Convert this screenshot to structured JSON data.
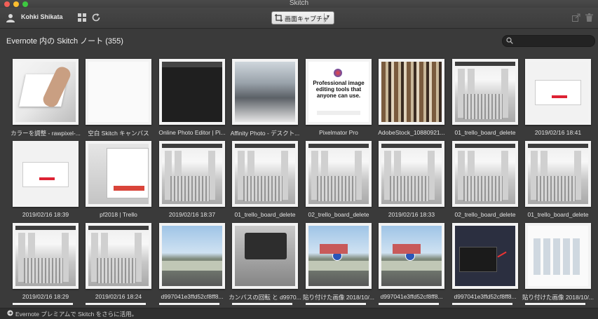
{
  "app": {
    "title": "Skitch"
  },
  "toolbar": {
    "username": "Kohki Shikata",
    "capture_label": "画面キャプチャ"
  },
  "header": {
    "title": "Evernote 内の Skitch ノート (355)",
    "search_value": ""
  },
  "notes": [
    {
      "caption": "カラーを調整 - rawpixel-...",
      "thumb": "hand"
    },
    {
      "caption": "空白 Skitch キャンバス",
      "thumb": "white"
    },
    {
      "caption": "Online Photo Editor | Pi...",
      "thumb": "dark"
    },
    {
      "caption": "Affinity Photo - デスクト...",
      "thumb": "mount"
    },
    {
      "caption": "Pixelmator Pro",
      "thumb": "pix"
    },
    {
      "caption": "AdobeStock_10880921...",
      "thumb": "books"
    },
    {
      "caption": "01_trello_board_delete",
      "thumb": "trello"
    },
    {
      "caption": "2019/02/16 18:41",
      "thumb": "dialog"
    },
    {
      "caption": "2019/02/16 18:39",
      "thumb": "dialog2"
    },
    {
      "caption": "pf2018 | Trello",
      "thumb": "pf"
    },
    {
      "caption": "2019/02/16 18:37",
      "thumb": "snow"
    },
    {
      "caption": "01_trello_board_delete",
      "thumb": "snow"
    },
    {
      "caption": "02_trello_board_delete",
      "thumb": "snow"
    },
    {
      "caption": "2019/02/16 18:33",
      "thumb": "snow"
    },
    {
      "caption": "02_trello_board_delete",
      "thumb": "snow"
    },
    {
      "caption": "01_trello_board_delete",
      "thumb": "snow"
    },
    {
      "caption": "2019/02/16 18:29",
      "thumb": "snow"
    },
    {
      "caption": "2019/02/16 18:24",
      "thumb": "snow"
    },
    {
      "caption": "d997041e3ffd52cf8ff8...",
      "thumb": "street"
    },
    {
      "caption": "カンバスの回転 と d9970...",
      "thumb": "rotate"
    },
    {
      "caption": "貼り付けた画像 2018/10/...",
      "thumb": "house"
    },
    {
      "caption": "d997041e3ffd52cf8ff8...",
      "thumb": "house2"
    },
    {
      "caption": "d997041e3ffd52cf8ff8...",
      "thumb": "menu"
    },
    {
      "caption": "貼り付けた画像 2018/10/...",
      "thumb": "finder"
    }
  ],
  "footer": {
    "text": "Evernote プレミアムで Skitch をさらに活用。"
  },
  "icons": {
    "avatar": "user-icon",
    "grid": "grid-view-icon",
    "refresh": "refresh-icon",
    "capture": "screen-capture-icon",
    "share": "share-icon",
    "trash": "trash-icon",
    "search": "search-icon",
    "footer": "arrow-circle-icon"
  }
}
